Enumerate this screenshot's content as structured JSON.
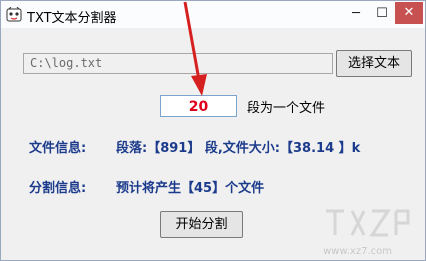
{
  "window": {
    "title": "TXT文本分割器",
    "controls": {
      "minimize": "─",
      "maximize": "☐",
      "close": "✕"
    }
  },
  "file": {
    "path_value": "C:\\log.txt",
    "select_button": "选择文本"
  },
  "split": {
    "count_value": "20",
    "count_suffix": "段为一个文件"
  },
  "info": {
    "file_info_label": "文件信息:",
    "file_info_value": "段落:【891】 段,文件大小:【38.14 】k",
    "split_info_label": "分割信息:",
    "split_info_value": "预计将产生【45】个文件"
  },
  "actions": {
    "start_button": "开始分割"
  },
  "watermark": {
    "text": "www.xz7.com"
  },
  "colors": {
    "info_text": "#1c3b8c",
    "count_text": "#e0001b",
    "annotation_arrow": "#d62020",
    "close_button": "#c75050"
  }
}
